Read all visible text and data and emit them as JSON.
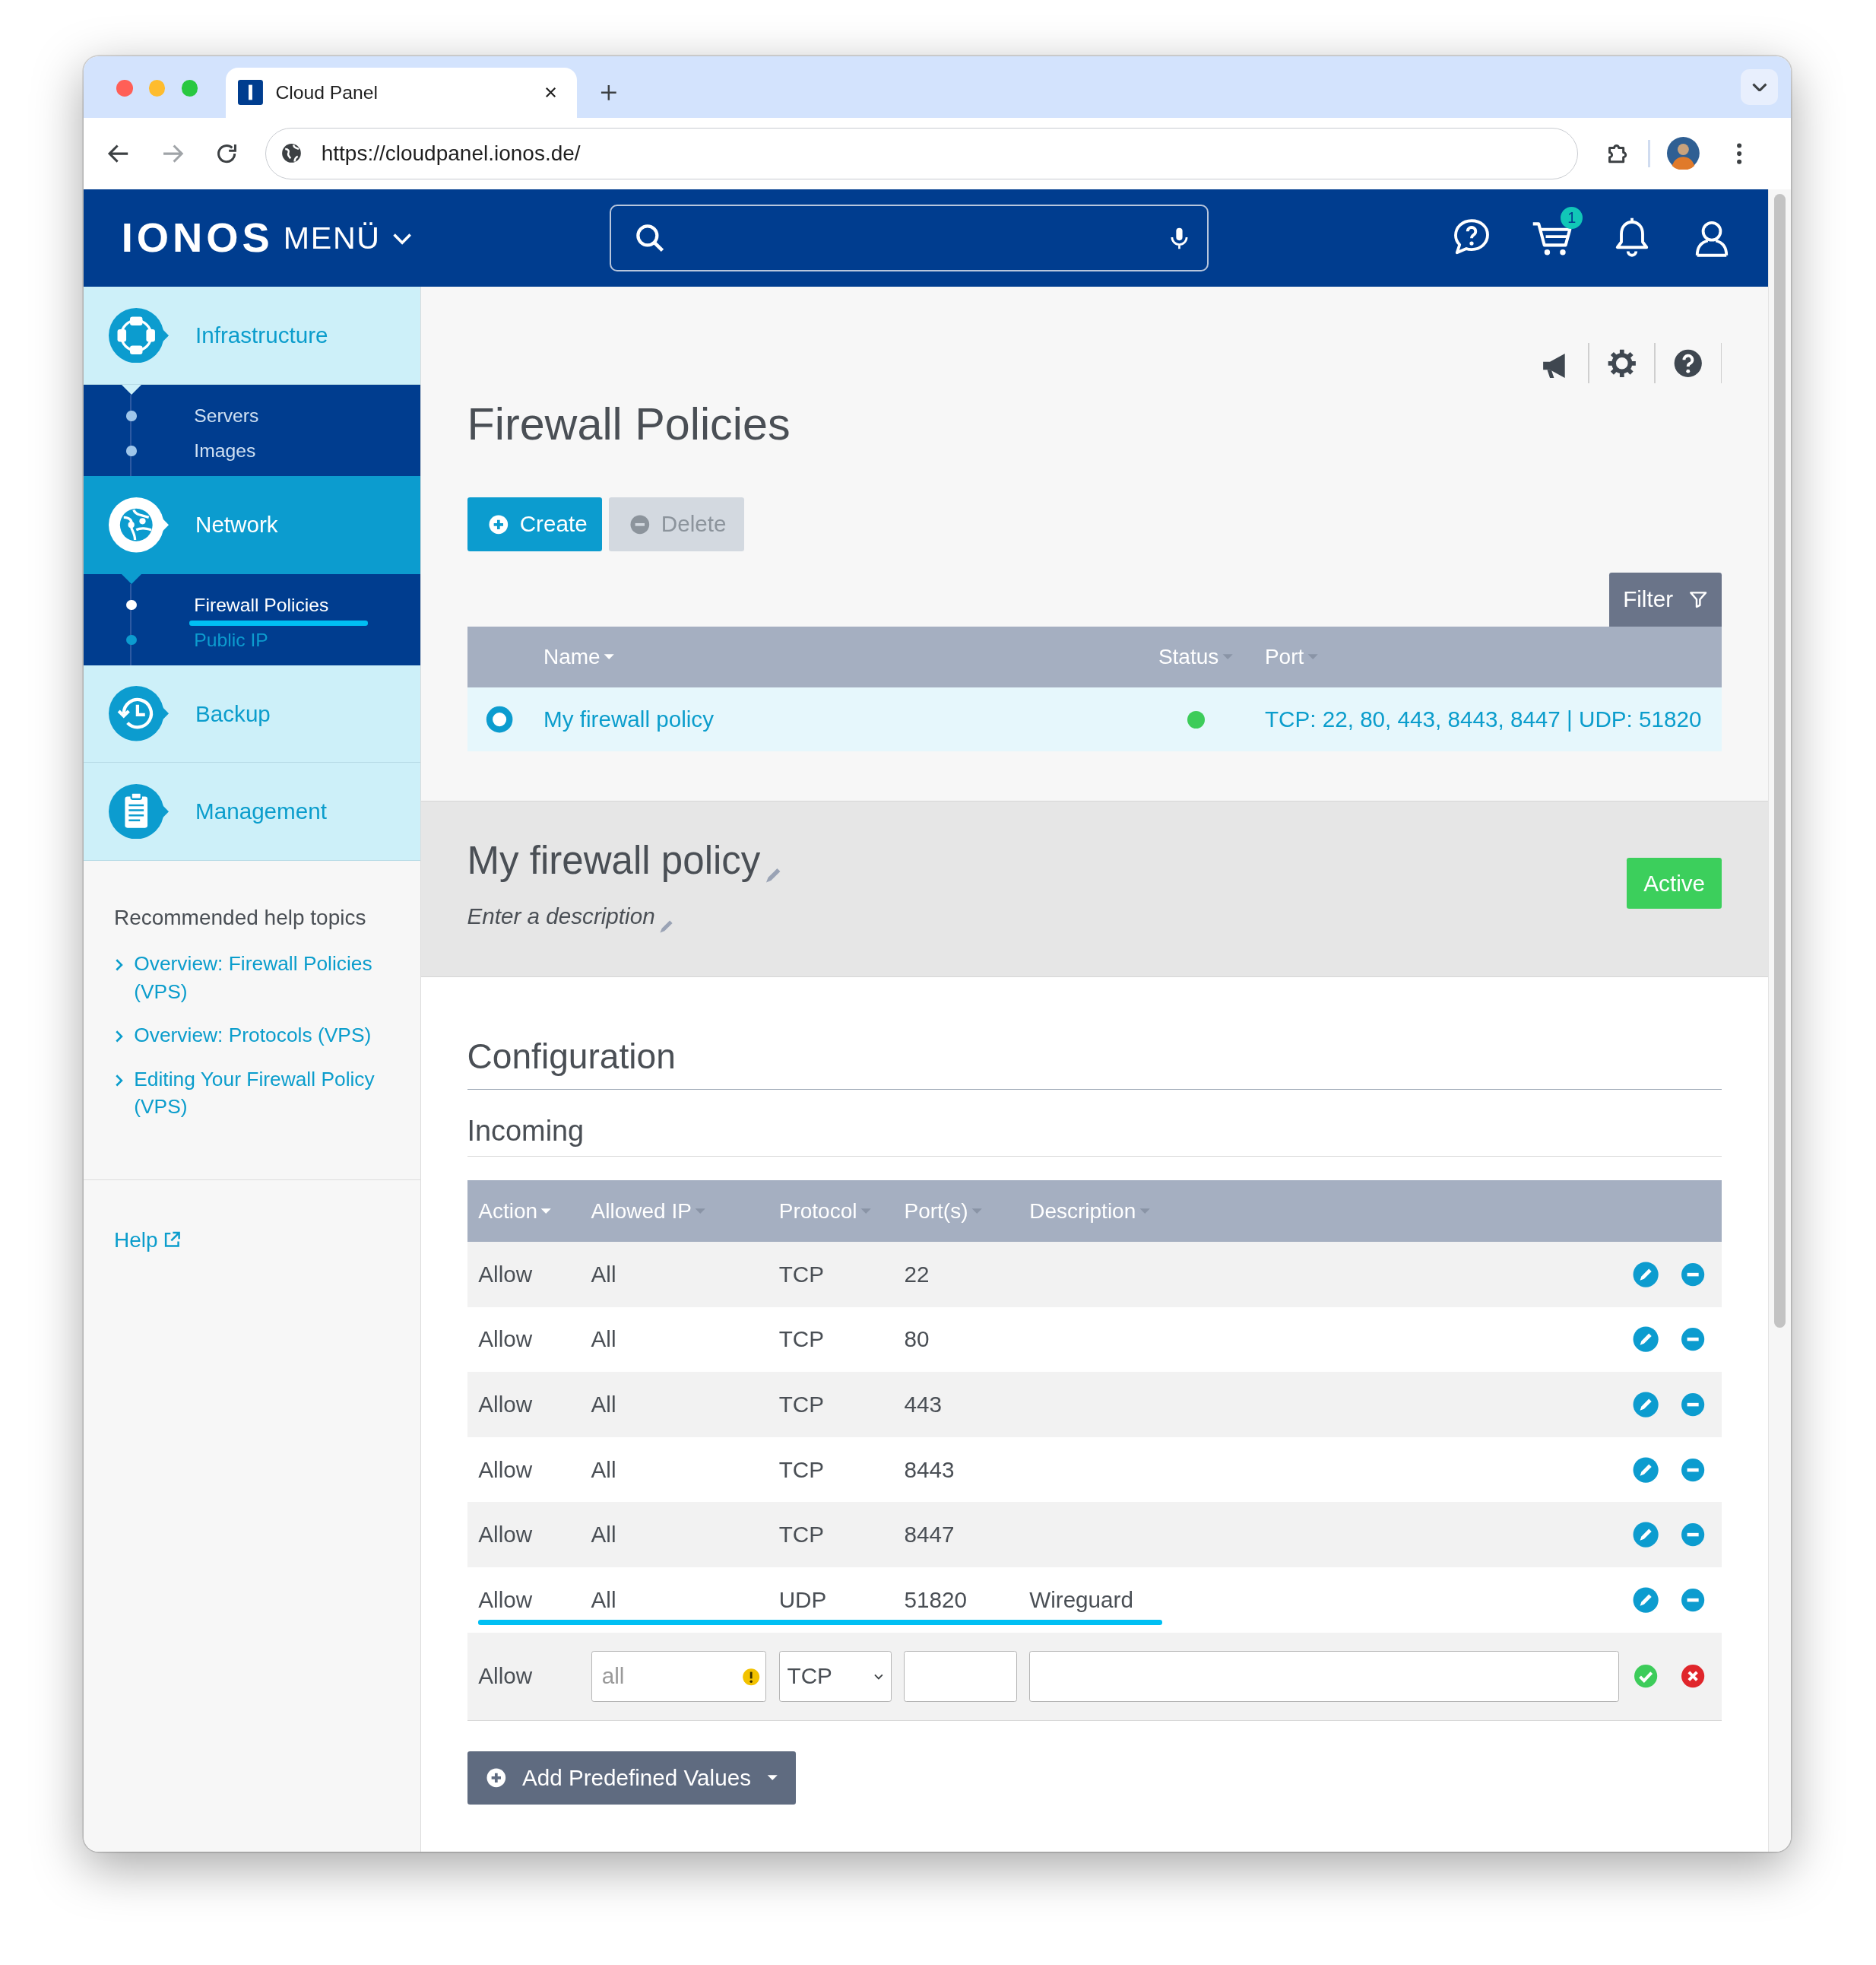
{
  "browser": {
    "tab_title": "Cloud Panel",
    "url": "https://cloudpanel.ionos.de/"
  },
  "header": {
    "logo": "IONOS",
    "menu": "MENÜ",
    "cart_count": "1"
  },
  "sidebar": {
    "items": [
      {
        "label": "Infrastructure",
        "selected": false,
        "expanded": true,
        "children": [
          {
            "label": "Servers",
            "selected": false,
            "highlighted": false
          },
          {
            "label": "Images",
            "selected": false,
            "highlighted": false
          }
        ]
      },
      {
        "label": "Network",
        "selected": true,
        "expanded": true,
        "children": [
          {
            "label": "Firewall Policies",
            "selected": true,
            "highlighted": true
          },
          {
            "label": "Public IP",
            "selected": false,
            "highlighted": false
          }
        ]
      },
      {
        "label": "Backup",
        "selected": false,
        "expanded": false
      },
      {
        "label": "Management",
        "selected": false,
        "expanded": false
      }
    ],
    "help_title": "Recommended help topics",
    "help_links": [
      "Overview: Firewall Policies (VPS)",
      "Overview: Protocols (VPS)",
      "Editing Your Firewall Policy (VPS)"
    ],
    "help": "Help"
  },
  "page": {
    "title": "Firewall Policies",
    "buttons": [
      {
        "label": "Create",
        "disabled": false
      },
      {
        "label": "Delete",
        "disabled": true
      }
    ],
    "filter": "Filter",
    "policies": {
      "columns": [
        {
          "label": "Name",
          "sorted": true
        },
        {
          "label": "Status",
          "sorted": false
        },
        {
          "label": "Port",
          "sorted": false
        }
      ],
      "rows": [
        {
          "name": "My firewall policy",
          "selected": true,
          "color": "#3dcc5a",
          "ports": "TCP: 22, 80, 443, 8443, 8447 | UDP: 51820"
        }
      ]
    }
  },
  "detail": {
    "name": "My firewall policy",
    "description": {
      "placeholder": "Enter a description"
    },
    "status": "Active"
  },
  "configuration": {
    "title": "Configuration",
    "section": "Incoming",
    "columns": [
      {
        "label": "Action",
        "sorted": true
      },
      {
        "label": "Allowed IP",
        "sorted": false
      },
      {
        "label": "Protocol",
        "sorted": false
      },
      {
        "label": "Port(s)",
        "sorted": false
      },
      {
        "label": "Description",
        "sorted": false
      }
    ],
    "rules": [
      {
        "action": "Allow",
        "ip": "All",
        "protocol": "TCP",
        "ports": "22",
        "highlighted": false
      },
      {
        "action": "Allow",
        "ip": "All",
        "protocol": "TCP",
        "ports": "80",
        "highlighted": false
      },
      {
        "action": "Allow",
        "ip": "All",
        "protocol": "TCP",
        "ports": "443",
        "highlighted": false
      },
      {
        "action": "Allow",
        "ip": "All",
        "protocol": "TCP",
        "ports": "8443",
        "highlighted": false
      },
      {
        "action": "Allow",
        "ip": "All",
        "protocol": "TCP",
        "ports": "8447",
        "highlighted": false
      },
      {
        "action": "Allow",
        "ip": "All",
        "protocol": "UDP",
        "ports": "51820",
        "description": "Wireguard",
        "highlighted": true
      }
    ],
    "new_rule": {
      "action": "Allow",
      "ip": {
        "placeholder": "all",
        "warning": true
      },
      "protocol": "TCP"
    },
    "add_button": "Add Predefined Values"
  }
}
